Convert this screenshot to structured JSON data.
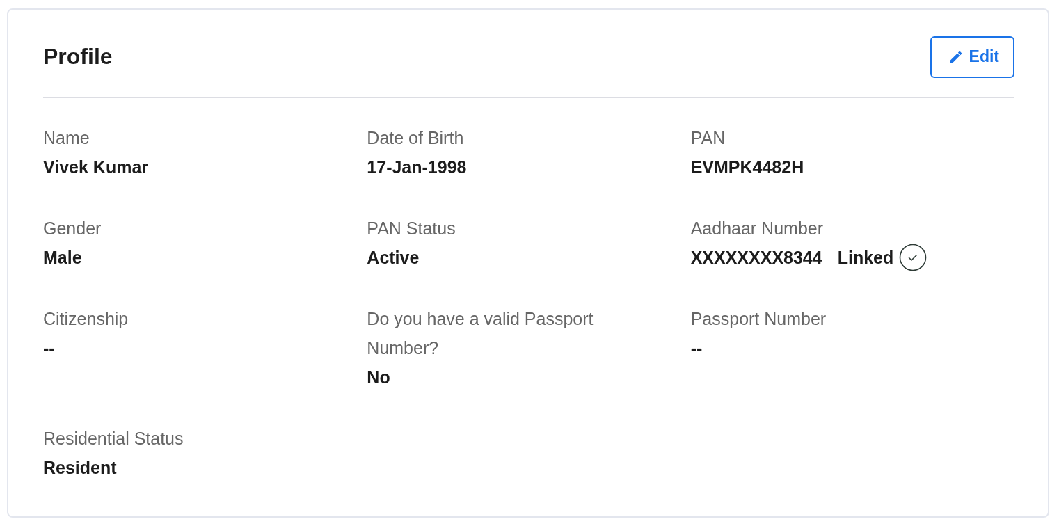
{
  "title": "Profile",
  "edit_button": {
    "label": "Edit"
  },
  "fields": [
    {
      "label": "Name",
      "value": "Vivek Kumar"
    },
    {
      "label": "Date of Birth",
      "value": "17-Jan-1998"
    },
    {
      "label": "PAN",
      "value": "EVMPK4482H"
    },
    {
      "label": "Gender",
      "value": "Male"
    },
    {
      "label": "PAN Status",
      "value": "Active"
    },
    {
      "label": "Aadhaar Number",
      "value": "XXXXXXXX8344",
      "status": "Linked",
      "verified": true
    },
    {
      "label": "Citizenship",
      "value": "--"
    },
    {
      "label": "Do you have a valid Passport Number?",
      "value": "No"
    },
    {
      "label": "Passport Number",
      "value": "--"
    },
    {
      "label": "Residential Status",
      "value": "Resident"
    }
  ]
}
